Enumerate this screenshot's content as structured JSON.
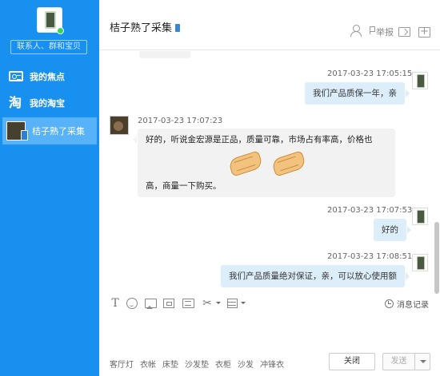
{
  "sidebar": {
    "search_placeholder": "联系人、群和宝贝",
    "items": [
      {
        "label": "我的焦点",
        "icon": "contact-card-icon"
      },
      {
        "label": "我的淘宝",
        "icon": "taobao-icon",
        "glyph": "淘"
      },
      {
        "label": "桔子熟了采集",
        "icon": "contact-avatar",
        "active": true
      }
    ]
  },
  "header": {
    "title": "桔子熟了采集",
    "report_label": "举报"
  },
  "messages": [
    {
      "side": "right",
      "time": "2017-03-23 17:05:15",
      "text": "我们产品质保一年，亲"
    },
    {
      "side": "left",
      "time": "2017-03-23 17:07:23",
      "text1": "好的，听说金宏源是正品，质量可靠，市场占有率高，价格也",
      "text2": "高，商量一下购买。",
      "emoji": [
        "handshake-emoji",
        "handshake-emoji"
      ]
    },
    {
      "side": "right",
      "time": "2017-03-23 17:07:53",
      "text": "好的"
    },
    {
      "side": "right",
      "time": "2017-03-23 17:08:51",
      "text": "我们产品质量绝对保证，亲，可以放心使用额"
    }
  ],
  "toolbar": {
    "font_glyph": "T",
    "cut_glyph": "✂",
    "history_label": "消息记录"
  },
  "quick_phrases": [
    "客厅灯",
    "衣帐",
    "床垫",
    "沙发垫",
    "衣柜",
    "沙发",
    "冲锋衣"
  ],
  "buttons": {
    "close": "关闭",
    "send": "发送"
  },
  "colors": {
    "sidebar": "#1890f0",
    "sidebar_active": "#58b2f8",
    "bubble_mine": "#ddeefb",
    "bubble_theirs": "#f2f2f2"
  }
}
